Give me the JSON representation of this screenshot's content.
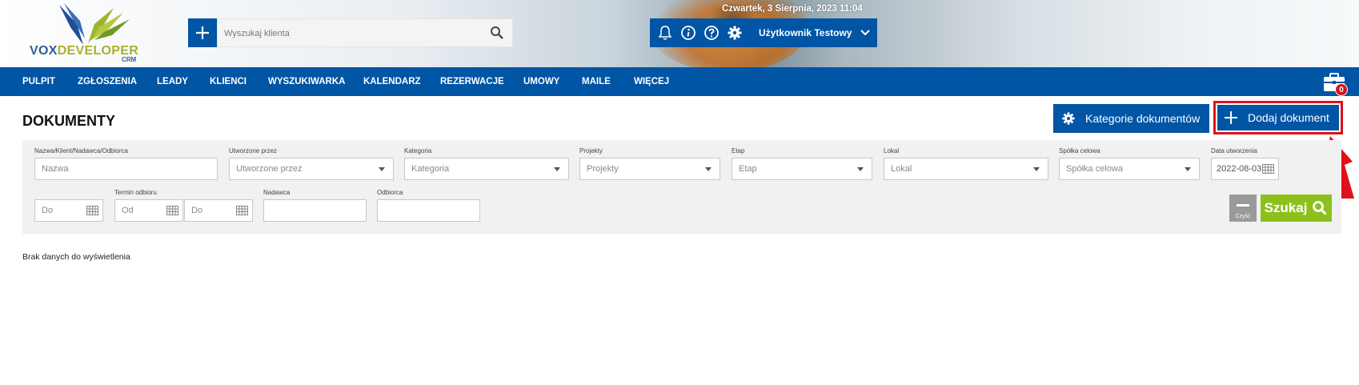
{
  "header": {
    "logo_text_main": "VOXDEVELOPER",
    "logo_text_sub": "CRM",
    "search": {
      "placeholder": "Wyszukaj klienta"
    },
    "datetime": "Czwartek, 3 Sierpnia, 2023   11:04",
    "user_name": "Użytkownik Testowy",
    "icons": [
      "plus-icon",
      "search-icon",
      "bell-icon",
      "info-icon",
      "help-icon",
      "gear-icon",
      "chevron-down-icon"
    ]
  },
  "nav": {
    "items": [
      "PULPIT",
      "ZGŁOSZENIA",
      "LEADY",
      "KLIENCI",
      "WYSZUKIWARKA",
      "KALENDARZ",
      "REZERWACJE",
      "UMOWY",
      "MAILE",
      "WIĘCEJ"
    ],
    "briefcase_count": "0"
  },
  "page": {
    "title": "DOKUMENTY",
    "btn_categories": "Kategorie dokumentów",
    "btn_add": "Dodaj dokument",
    "no_data": "Brak danych do wyświetlenia"
  },
  "filters": {
    "name": {
      "label": "Nazwa/Klient/Nadawca/Odbiorca",
      "placeholder": "Nazwa"
    },
    "created_by": {
      "label": "Utworzone przez",
      "placeholder": "Utworzone przez"
    },
    "category": {
      "label": "Kategoria",
      "placeholder": "Kategoria"
    },
    "projects": {
      "label": "Projekty",
      "placeholder": "Projekty"
    },
    "stage": {
      "label": "Etap",
      "placeholder": "Etap"
    },
    "unit": {
      "label": "Lokal",
      "placeholder": "Lokal"
    },
    "spv": {
      "label": "Spółka celowa",
      "placeholder": "Spółka celowa"
    },
    "created_date": {
      "label": "Data utworzenia",
      "value": "2022-08-03"
    },
    "date_to": {
      "placeholder": "Do"
    },
    "pickup": {
      "label": "Termin odbioru",
      "from_placeholder": "Od",
      "to_placeholder": "Do"
    },
    "sender": {
      "label": "Nadawca"
    },
    "recipient": {
      "label": "Odbiorca"
    },
    "btn_clear": "Czyść",
    "btn_search": "Szukaj"
  },
  "colors": {
    "primary": "#0055a5",
    "accent_green": "#8cc11c",
    "highlight_red": "#e0101a",
    "panel_bg": "#f1f1f1"
  }
}
